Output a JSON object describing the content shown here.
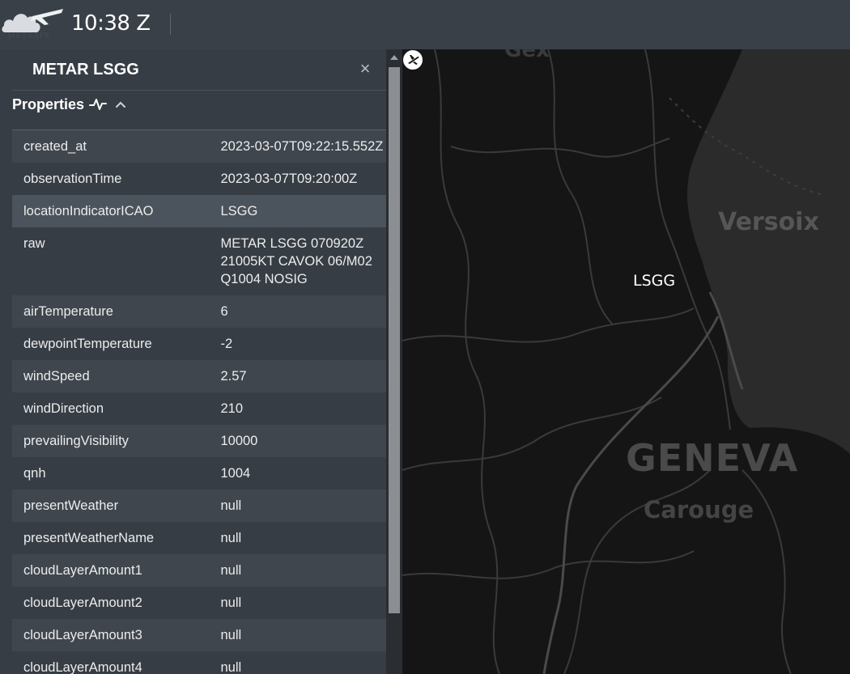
{
  "header": {
    "logo_text": "METSAFE",
    "clock": "10:38 Z"
  },
  "panel": {
    "title": "METAR LSGG",
    "close_symbol": "×",
    "section_label": "Properties",
    "properties": [
      {
        "key": "created_at",
        "value": "2023-03-07T09:22:15.552Z"
      },
      {
        "key": "observationTime",
        "value": "2023-03-07T09:20:00Z"
      },
      {
        "key": "locationIndicatorICAO",
        "value": "LSGG"
      },
      {
        "key": "raw",
        "value": "METAR LSGG 070920Z 21005KT CAVOK 06/M02 Q1004 NOSIG"
      },
      {
        "key": "airTemperature",
        "value": "6"
      },
      {
        "key": "dewpointTemperature",
        "value": "-2"
      },
      {
        "key": "windSpeed",
        "value": "2.57"
      },
      {
        "key": "windDirection",
        "value": "210"
      },
      {
        "key": "prevailingVisibility",
        "value": "10000"
      },
      {
        "key": "qnh",
        "value": "1004"
      },
      {
        "key": "presentWeather",
        "value": "null"
      },
      {
        "key": "presentWeatherName",
        "value": "null"
      },
      {
        "key": "cloudLayerAmount1",
        "value": "null"
      },
      {
        "key": "cloudLayerAmount2",
        "value": "null"
      },
      {
        "key": "cloudLayerAmount3",
        "value": "null"
      },
      {
        "key": "cloudLayerAmount4",
        "value": "null"
      }
    ]
  },
  "map": {
    "labels": {
      "gex": "Gex",
      "versoix": "Versoix",
      "geneva": "GENEVA",
      "carouge": "Carouge"
    },
    "station_label": "LSGG",
    "station_icon": "airport-icon"
  }
}
